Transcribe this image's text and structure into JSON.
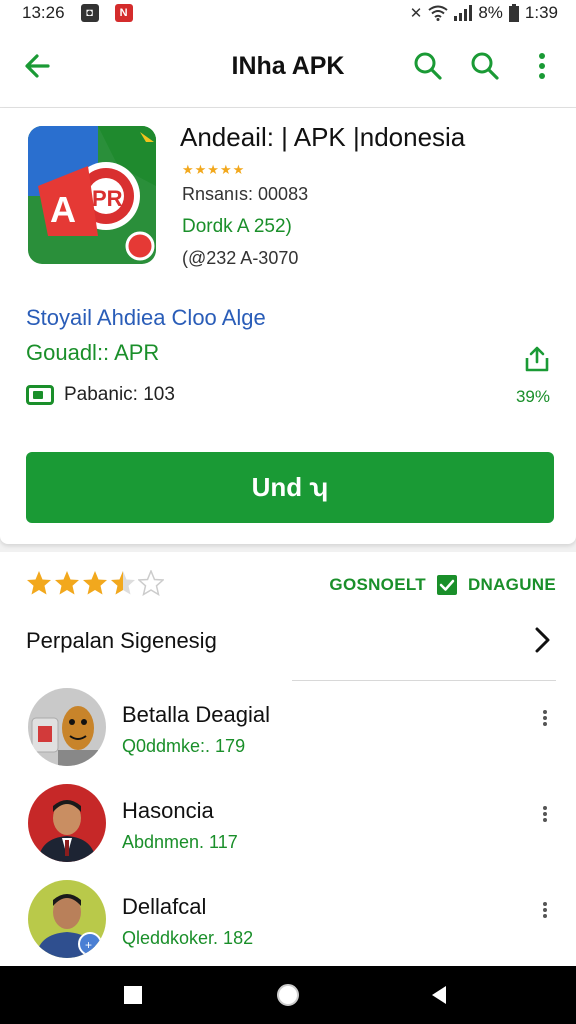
{
  "status_bar": {
    "time_left": "13:26",
    "battery": "8%",
    "time_right": "1:39"
  },
  "app_bar": {
    "title": "INha APK"
  },
  "app": {
    "name": "Andeail: | APK |ndonesia",
    "stars_text": "★★★★★",
    "meta1": "Rnsanıs: 00083",
    "meta2": "Dordk A 252)",
    "meta3": "(@232 A-3070",
    "developer": "Stoyail Ahdiea Cloo Alge",
    "group": "Gouadl:: APR",
    "size_label": "Pabanic: 103",
    "percent": "39%",
    "install_label": "Und ʮ"
  },
  "ratings": {
    "value": 3.5,
    "badge_left": "GOSNOELT",
    "badge_right": "DNAGUNE"
  },
  "section": {
    "title": "Perpalan Sigenesig"
  },
  "list": [
    {
      "name": "Betalla Deagial",
      "sub": "Q0ddmke:. 179"
    },
    {
      "name": "Hasoncia",
      "sub": "Abdnmen. 117"
    },
    {
      "name": "Dellafcal",
      "sub": "Qleddkoker. 182"
    }
  ],
  "colors": {
    "accent_green": "#1a9a35",
    "link_blue": "#2a5db8",
    "star_yellow": "#f2a81d"
  }
}
